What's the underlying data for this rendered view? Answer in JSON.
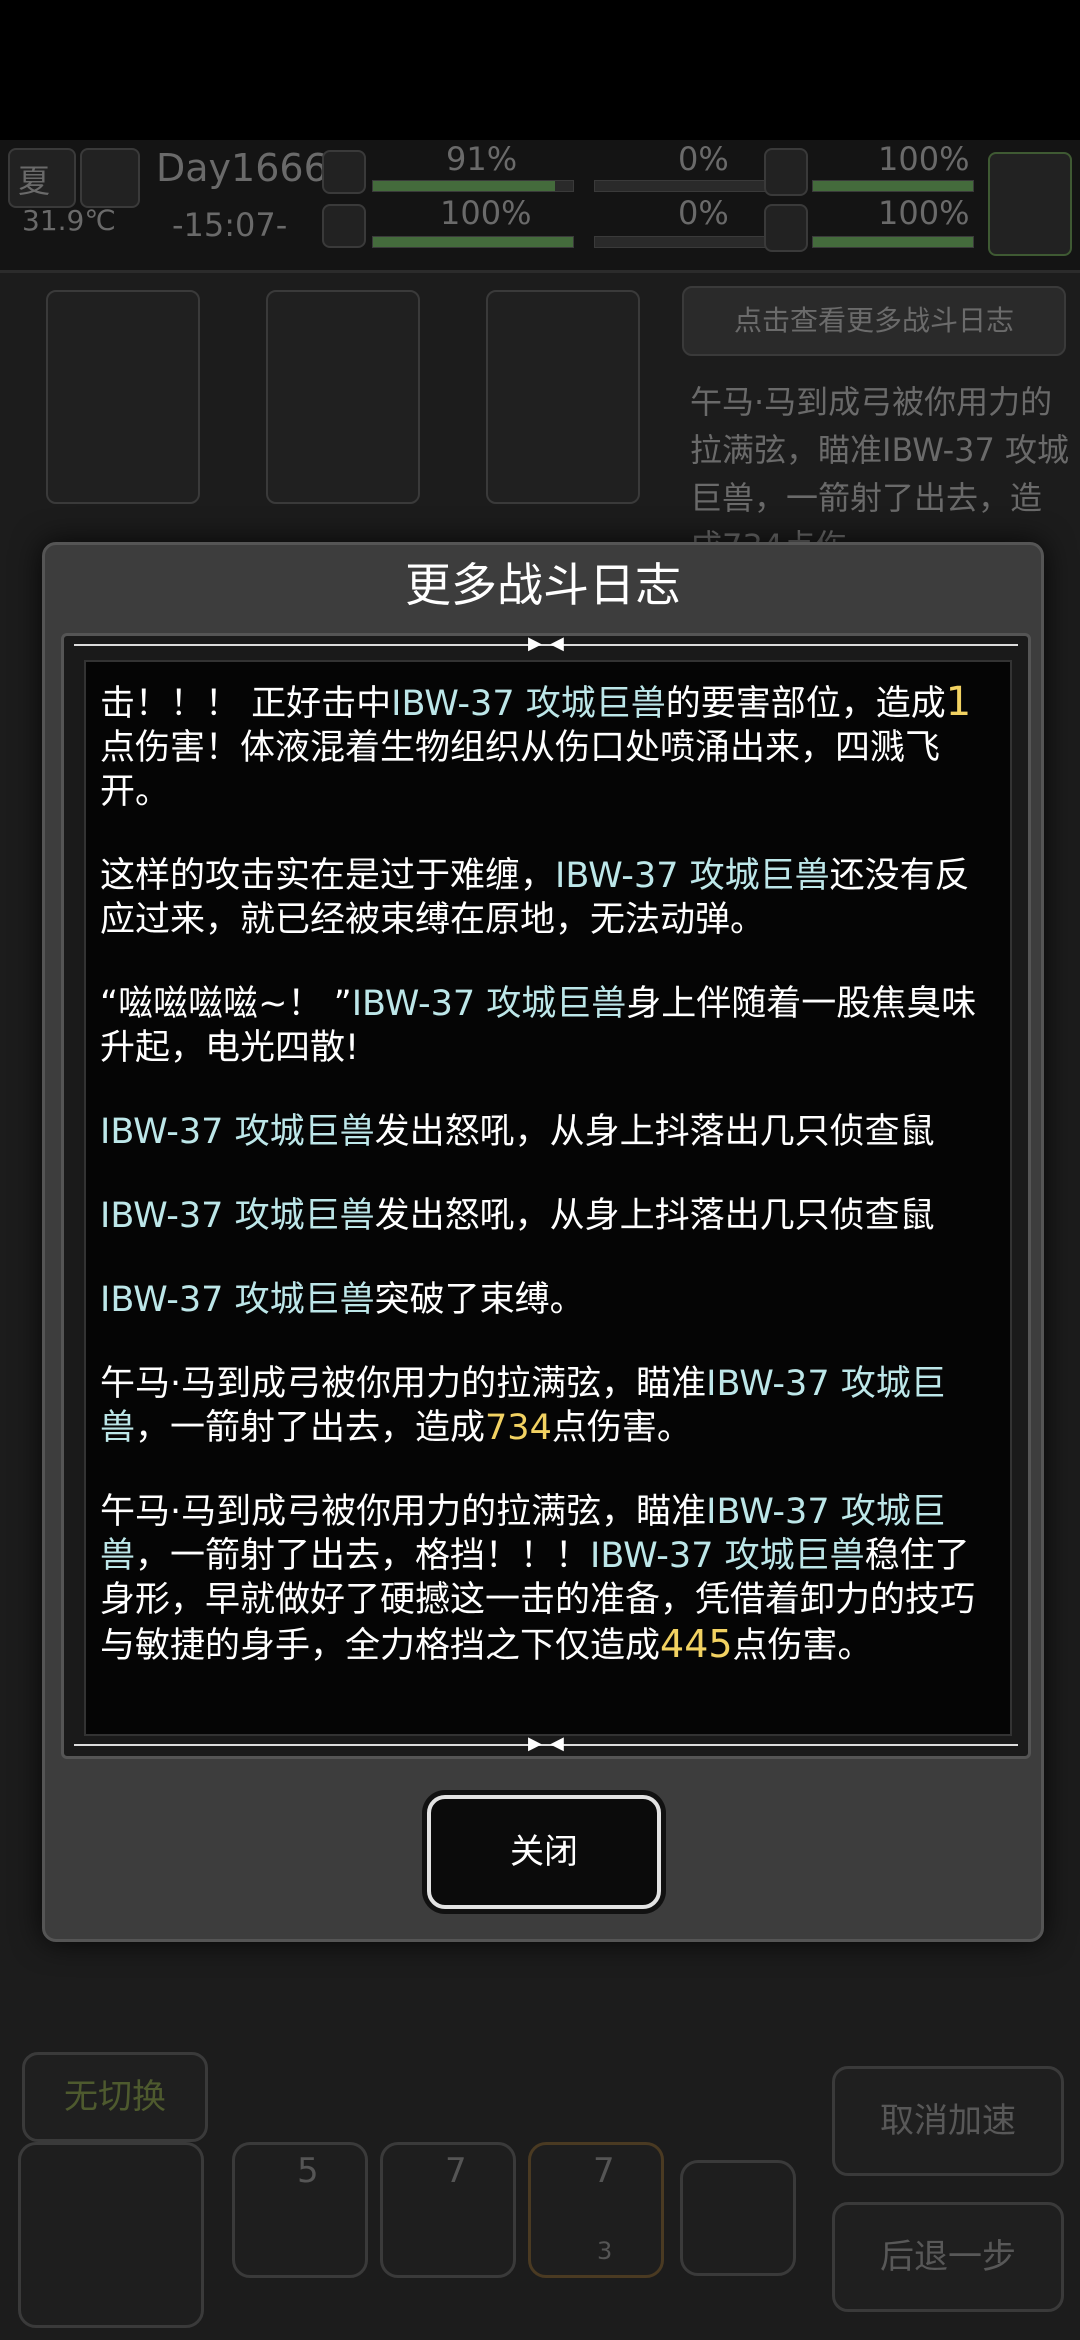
{
  "hud": {
    "season": "夏",
    "temperature": "31.9℃",
    "day": "Day1666",
    "time": "-15:07-",
    "stats": [
      {
        "value": "91%",
        "fill": 0.91
      },
      {
        "value": "100%",
        "fill": 1.0
      },
      {
        "value": "0%",
        "fill": 0.0
      },
      {
        "value": "0%",
        "fill": 0.0
      },
      {
        "value": "100%",
        "fill": 1.0
      },
      {
        "value": "100%",
        "fill": 1.0
      }
    ]
  },
  "side_panel": {
    "log_button": "点击查看更多战斗日志",
    "log_preview": "午马·马到成弓被你用力的拉满弦，瞄准IBW-37 攻城巨兽，一箭射了出去，造成734点伤"
  },
  "bottom": {
    "no_switch": "无切换",
    "cancel_speed": "取消加速",
    "step_back": "后退一步",
    "tools": [
      {
        "count": "5"
      },
      {
        "count": "7"
      },
      {
        "count": "7",
        "sub": "3"
      }
    ]
  },
  "modal": {
    "title": "更多战斗日志",
    "close_label": "关闭",
    "log": {
      "p1": {
        "a": "击！！！ 正好击中",
        "monster": "IBW-37 攻城巨兽",
        "b": "的要害部位，造成",
        "dmg": "1",
        "c": "点伤害！体液混着生物组织从伤口处喷涌出来，四溅飞开。"
      },
      "p2": {
        "a": "这样的攻击实在是过于难缠，",
        "monster": "IBW-37 攻城巨兽",
        "b": "还没有反应过来，就已经被束缚在原地，无法动弹。"
      },
      "p3": {
        "a": "“嗞嗞嗞嗞~！ ”",
        "monster": "IBW-37 攻城巨兽",
        "b": "身上伴随着一股焦臭味升起，电光四散!"
      },
      "p4": {
        "monster": "IBW-37 攻城巨兽",
        "b": "发出怒吼，从身上抖落出几只侦查鼠"
      },
      "p5": {
        "monster": "IBW-37 攻城巨兽",
        "b": "发出怒吼，从身上抖落出几只侦查鼠"
      },
      "p6": {
        "monster": "IBW-37 攻城巨兽",
        "b": "突破了束缚。"
      },
      "p7": {
        "a": "午马·马到成弓被你用力的拉满弦，瞄准",
        "monster": "IBW-37 攻城巨兽",
        "b": "，一箭射了出去，造成",
        "dmg": "734",
        "c": "点伤害。"
      },
      "p8": {
        "a": "午马·马到成弓被你用力的拉满弦，瞄准",
        "monster": "IBW-37 攻城巨兽",
        "b": "，一箭射了出去，格挡！！！",
        "monster2": "IBW-37 攻城巨兽",
        "c": "稳住了身形，早就做好了硬撼这一击的准备，凭借着卸力的技巧与敏捷的身手，全力格挡之下仅造成",
        "dmg": "445",
        "d": "点伤害。"
      }
    }
  }
}
